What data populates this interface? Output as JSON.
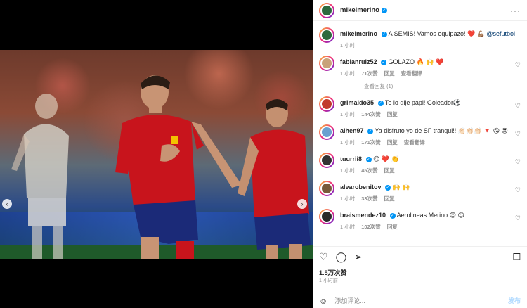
{
  "post": {
    "username": "mikelmerino",
    "more_icon": "ellipsis-icon",
    "caption_user": "mikelmerino",
    "caption_text": "A SEMIS! Vamos equipazo! ❤️ 💪🏽 ",
    "caption_mention": "@sefutbol",
    "caption_time": "1 小时",
    "likes": "1.5万次赞",
    "time": "1 小时前",
    "add_comment_placeholder": "添加评论...",
    "post_button": "发布",
    "carousel_dots": 6,
    "carousel_active": 0
  },
  "comments": [
    {
      "user": "fabianruiz52",
      "text": "GOLAZO 🔥 🙌 ❤️",
      "time": "1 小时",
      "likes": "71次赞",
      "reply": "回复",
      "translate": "查看翻译",
      "replies": "查看回复 (1)",
      "avatar_color": "#c9a27a"
    },
    {
      "user": "grimaldo35",
      "text": "Te lo dije papi! Goleador⚽",
      "time": "1 小时",
      "likes": "144次赞",
      "reply": "回复",
      "translate": "",
      "replies": "",
      "avatar_color": "#c23a2c"
    },
    {
      "user": "aihen97",
      "text": "Ya disfruto yo de SF tranqui!! 👏🏻👏🏻👏🏻 🔻 😘 😍",
      "time": "1 小时",
      "likes": "171次赞",
      "reply": "回复",
      "translate": "查看翻译",
      "replies": "",
      "avatar_color": "#6aa0d0"
    },
    {
      "user": "tuurrii8",
      "text": "😍 ❤️ 👏",
      "time": "1 小时",
      "likes": "45次赞",
      "reply": "回复",
      "translate": "",
      "replies": "",
      "avatar_color": "#333333"
    },
    {
      "user": "alvarobenitov",
      "text": "🙌 🙌",
      "time": "1 小时",
      "likes": "33次赞",
      "reply": "回复",
      "translate": "",
      "replies": "",
      "avatar_color": "#7a5a3a"
    },
    {
      "user": "braismendez10",
      "text": "Aerolineas Merino 😍 😍",
      "time": "1 小时",
      "likes": "102次赞",
      "reply": "回复",
      "translate": "",
      "replies": "",
      "avatar_color": "#2a2a2a"
    }
  ]
}
